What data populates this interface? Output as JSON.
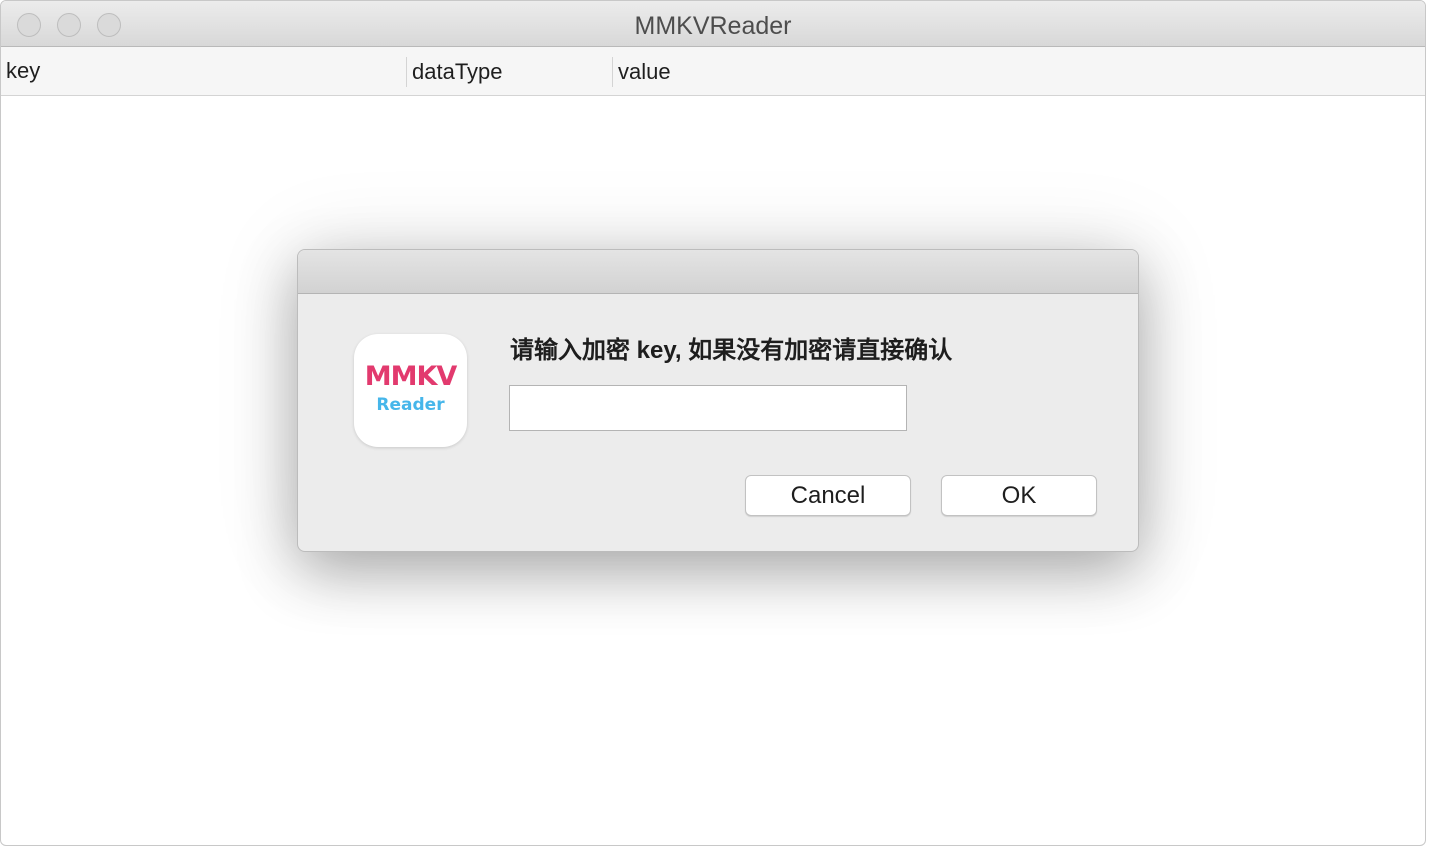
{
  "window": {
    "title": "MMKVReader",
    "controls": [
      "close",
      "minimize",
      "zoom"
    ]
  },
  "table": {
    "columns": [
      {
        "label": "key"
      },
      {
        "label": "dataType"
      },
      {
        "label": "value"
      }
    ],
    "rows": []
  },
  "dialog": {
    "prompt": "请输入加密 key, 如果没有加密请直接确认",
    "input": {
      "value": "",
      "placeholder": ""
    },
    "icon": {
      "name": "mmkv-reader-app-icon",
      "text_top": "MMKV",
      "text_bottom": "Reader",
      "colors": {
        "top": "#e23a6e",
        "bottom": "#46b6ea"
      }
    },
    "buttons": {
      "cancel_label": "Cancel",
      "ok_label": "OK"
    }
  }
}
